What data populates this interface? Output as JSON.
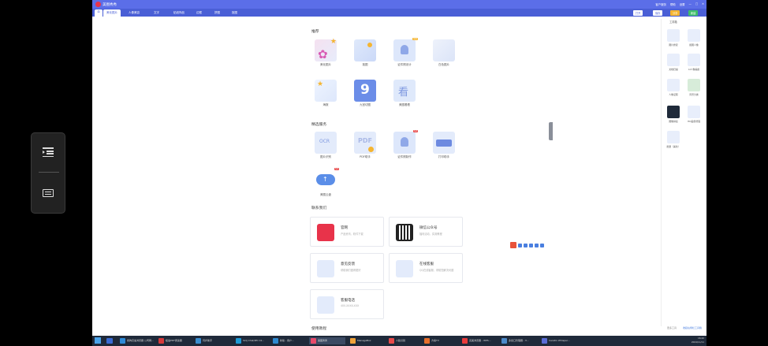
{
  "window": {
    "app_name": "美图秀秀",
    "title_right": [
      "客户服务",
      "帮助",
      "设置",
      "—",
      "□",
      "✕"
    ]
  },
  "tabs": [
    "美化图片",
    "人像美容",
    "文字",
    "贴纸饰品",
    "边框",
    "拼图",
    "抠图"
  ],
  "header_buttons": {
    "open": "打开",
    "save": "保存",
    "save_share": "分享",
    "new": "新建"
  },
  "sections": {
    "recommend": "推荐",
    "featured": "精选服务",
    "contact": "联系我们",
    "tutorials": "使用教程"
  },
  "recommend_tiles": [
    {
      "label": "美化图片",
      "tag": ""
    },
    {
      "label": "抠图",
      "tag": ""
    },
    {
      "label": "证件照设计",
      "tag": "new"
    },
    {
      "label": "白色图片",
      "tag": ""
    },
    {
      "label": "海报",
      "tag": ""
    },
    {
      "label": "九宫切图",
      "tag": ""
    },
    {
      "label": "美图看看",
      "tag": ""
    }
  ],
  "featured_tiles": [
    {
      "label": "图片识别",
      "tag": ""
    },
    {
      "label": "PDF助手",
      "tag": ""
    },
    {
      "label": "证件照制作",
      "tag": "hot"
    },
    {
      "label": "打印助手",
      "tag": ""
    },
    {
      "label": "美图云盘",
      "tag": "hot"
    }
  ],
  "contact_cards": [
    {
      "title": "官网",
      "sub": "产品资讯、软件下载"
    },
    {
      "title": "微信公众号",
      "sub": "福利活动、实用教程"
    },
    {
      "title": "意见反馈",
      "sub": "帮助我们做得更好"
    },
    {
      "title": "在线客服",
      "sub": "QQ在线客服、帮助您解决问题"
    },
    {
      "title": "客服电话",
      "sub": "400-XXXX-XXX"
    }
  ],
  "right_panel": {
    "title": "工具箱",
    "items": [
      "图片修复",
      "抠图人像",
      "文档扫描",
      "AI人像美颜",
      "人像证照",
      "风景分类",
      "图像拼接",
      "HD画质增强",
      "批量（美化）"
    ],
    "bottom_left": "更多工具",
    "bottom_right": "收起右侧栏工具箱"
  },
  "float_panel": {
    "top_icon": "indent-icon",
    "bottom_icon": "keyboard-icon"
  },
  "taskbar": {
    "items": [
      "搜狗高速浏览器 公司网...",
      "极速PDF阅读器",
      "同步助手",
      "SCIJ Chat/IPC Cli...",
      "新版 -  用户...",
      "美图秀秀",
      "ManageBox",
      "人脸识别",
      "方案TV",
      "完美浏览器 - WPS...",
      "多窗口管理器 - V...",
      "Ceratin Whisper..."
    ],
    "time": "16:42",
    "date": "2024/11/11",
    "colors": [
      "#2e8bd8",
      "#d6393a",
      "#3b8ed0",
      "#1e9bd7",
      "#2f8ad0",
      "#e84a6a",
      "#f1a33a",
      "#e84a4a",
      "#e66e2b",
      "#e83b3b",
      "#4c8ac9",
      "#5a6cd6"
    ]
  }
}
